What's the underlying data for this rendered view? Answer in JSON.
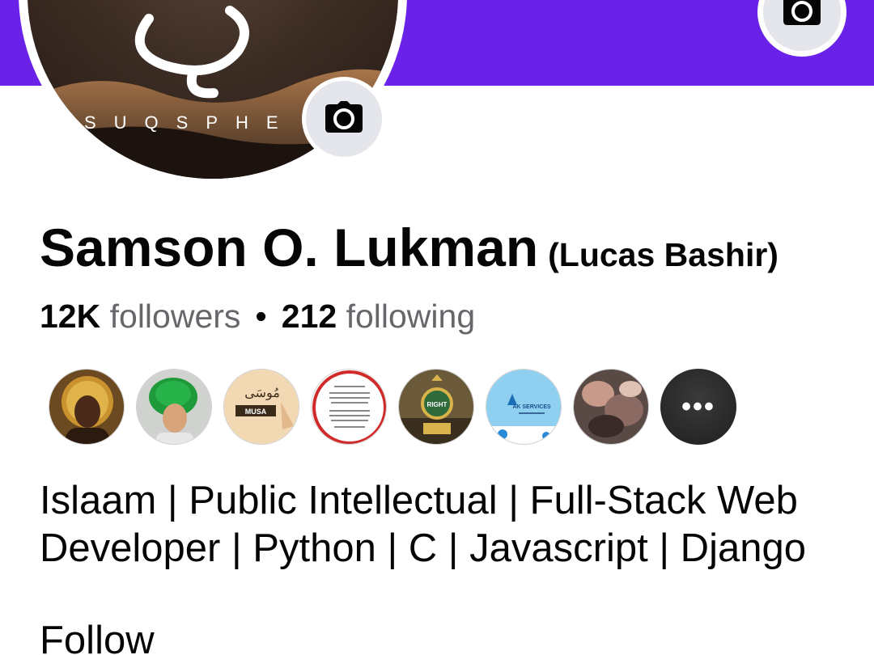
{
  "profile": {
    "brand_text": "SUQSPHE",
    "name": "Samson O. Lukman",
    "alternate_name": "(Lucas Bashir)",
    "followers_count": "12K",
    "followers_label": "followers",
    "following_count": "212",
    "following_label": "following",
    "separator": "•",
    "bio_line1": "Islaam | Public Intellectual | Full-Stack Web",
    "bio_line2": "Developer | Python | C | Javascript | Django",
    "follow_label": "Follow"
  },
  "featured": {
    "items": [
      {
        "label": "",
        "kind": "portrait-gold"
      },
      {
        "label": "",
        "kind": "portrait-green"
      },
      {
        "label": "MUSA",
        "kind": "musa-card"
      },
      {
        "label": "",
        "kind": "text-card"
      },
      {
        "label": "RIGHT",
        "kind": "trophy"
      },
      {
        "label": "AK SERVICES",
        "kind": "ak-services"
      },
      {
        "label": "",
        "kind": "photo"
      }
    ],
    "more_label": "•••"
  },
  "icons": {
    "cover_camera": "camera-icon",
    "avatar_camera": "camera-icon",
    "more": "more-icon"
  },
  "colors": {
    "cover": "#6b22e8",
    "text": "#050505",
    "secondary_text": "#65676b",
    "button_bg": "#e4e6eb"
  }
}
